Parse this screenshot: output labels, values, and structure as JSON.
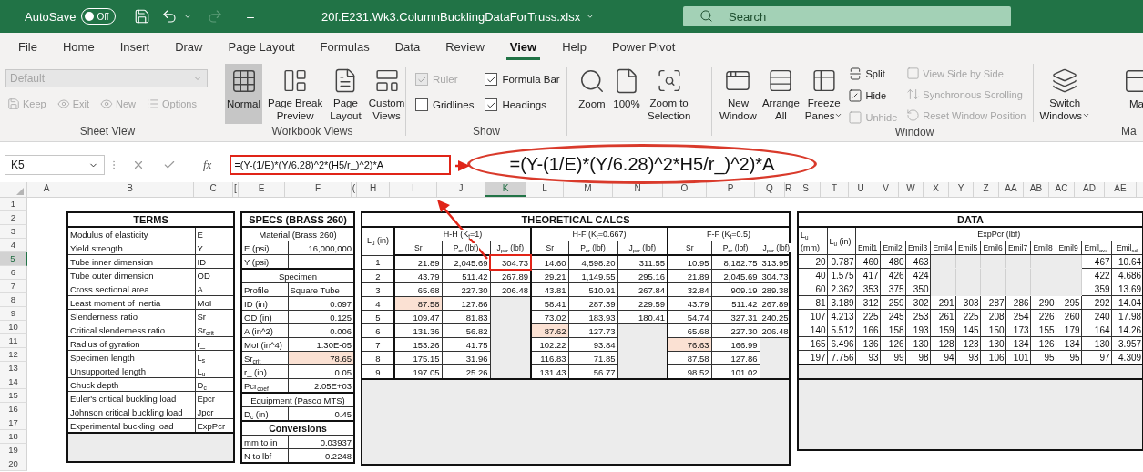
{
  "title_bar": {
    "autosave_label": "AutoSave",
    "autosave": {
      "on": false,
      "label": "Off"
    },
    "redo": {
      "disabled": true
    },
    "filename": "20f.E231.Wk3.ColumnBucklingDataForTruss.xlsx",
    "search": {
      "placeholder": "Search"
    }
  },
  "menu_tabs": [
    {
      "label": "File",
      "selected": false
    },
    {
      "label": "Home",
      "selected": false
    },
    {
      "label": "Insert",
      "selected": false
    },
    {
      "label": "Draw",
      "selected": false
    },
    {
      "label": "Page Layout",
      "selected": false
    },
    {
      "label": "Formulas",
      "selected": false
    },
    {
      "label": "Data",
      "selected": false
    },
    {
      "label": "Review",
      "selected": false
    },
    {
      "label": "View",
      "selected": true
    },
    {
      "label": "Help",
      "selected": false
    },
    {
      "label": "Power Pivot",
      "selected": false
    }
  ],
  "ribbon": {
    "sheet_view": {
      "label": "Sheet View",
      "dropdown": {
        "value": "Default",
        "disabled": true
      },
      "buttons": [
        {
          "label": "Keep",
          "disabled": true
        },
        {
          "label": "Exit",
          "disabled": true
        },
        {
          "label": "New",
          "disabled": true
        },
        {
          "label": "Options",
          "disabled": true
        }
      ]
    },
    "workbook_views": {
      "label": "Workbook Views",
      "buttons": [
        {
          "lines": [
            "Normal"
          ],
          "selected": true
        },
        {
          "lines": [
            "Page Break",
            "Preview"
          ],
          "selected": false
        },
        {
          "lines": [
            "Page",
            "Layout"
          ],
          "selected": false
        },
        {
          "lines": [
            "Custom",
            "Views"
          ],
          "selected": false
        }
      ]
    },
    "show": {
      "label": "Show",
      "options": [
        {
          "label": "Ruler",
          "checked": true,
          "disabled": true
        },
        {
          "label": "Formula Bar",
          "checked": true,
          "disabled": false
        },
        {
          "label": "Gridlines",
          "checked": false,
          "disabled": false
        },
        {
          "label": "Headings",
          "checked": true,
          "disabled": false
        }
      ]
    },
    "zoom": {
      "buttons": [
        {
          "lines": [
            "Zoom"
          ]
        },
        {
          "lines": [
            "100%"
          ]
        },
        {
          "lines": [
            "Zoom to",
            "Selection"
          ]
        }
      ]
    },
    "window": {
      "label": "Window",
      "large_buttons": [
        {
          "lines": [
            "New",
            "Window"
          ],
          "dropdown": false
        },
        {
          "lines": [
            "Arrange",
            "All"
          ],
          "dropdown": false
        },
        {
          "lines": [
            "Freeze",
            "Panes"
          ],
          "dropdown": true
        }
      ],
      "small_buttons": [
        {
          "label": "Split",
          "disabled": false
        },
        {
          "label": "Hide",
          "disabled": false
        },
        {
          "label": "Unhide",
          "disabled": true
        }
      ],
      "side_buttons": [
        {
          "label": "View Side by Side",
          "disabled": true
        },
        {
          "label": "Synchronous Scrolling",
          "disabled": true
        },
        {
          "label": "Reset Window Position",
          "disabled": true
        }
      ],
      "switch": {
        "lines": [
          "Switch",
          "Windows"
        ],
        "dropdown": true
      }
    },
    "macros": {
      "button_label": "Ma",
      "group_label": "Ma"
    }
  },
  "formula_bar": {
    "name_box": "K5",
    "function_label": "fx",
    "formula": "=(Y-(1/E)*(Y/6.28)^2*(H5/r_)^2)*A"
  },
  "callout": {
    "text": "=(Y-(1/E)*(Y/6.28)^2*H5/r_)^2)*A"
  },
  "columns": [
    {
      "label": "A",
      "selected": false
    },
    {
      "label": "B",
      "selected": false
    },
    {
      "label": "C",
      "selected": false
    },
    {
      "label": "[",
      "selected": false
    },
    {
      "label": "E",
      "selected": false
    },
    {
      "label": "F",
      "selected": false
    },
    {
      "label": "(",
      "selected": false
    },
    {
      "label": "H",
      "selected": false
    },
    {
      "label": "I",
      "selected": false
    },
    {
      "label": "J",
      "selected": false
    },
    {
      "label": "K",
      "selected": true
    },
    {
      "label": "L",
      "selected": false
    },
    {
      "label": "M",
      "selected": false
    },
    {
      "label": "N",
      "selected": false
    },
    {
      "label": "O",
      "selected": false
    },
    {
      "label": "P",
      "selected": false
    },
    {
      "label": "Q",
      "selected": false
    },
    {
      "label": "R",
      "selected": false
    },
    {
      "label": "S",
      "selected": false
    },
    {
      "label": "T",
      "selected": false
    },
    {
      "label": "U",
      "selected": false
    },
    {
      "label": "V",
      "selected": false
    },
    {
      "label": "W",
      "selected": false
    },
    {
      "label": "X",
      "selected": false
    },
    {
      "label": "Y",
      "selected": false
    },
    {
      "label": "Z",
      "selected": false
    },
    {
      "label": "AA",
      "selected": false
    },
    {
      "label": "AB",
      "selected": false
    },
    {
      "label": "AC",
      "selected": false
    },
    {
      "label": "AD",
      "selected": false
    },
    {
      "label": "AE",
      "selected": false
    }
  ],
  "rows": [
    {
      "label": "1",
      "selected": false
    },
    {
      "label": "2",
      "selected": false
    },
    {
      "label": "3",
      "selected": false
    },
    {
      "label": "4",
      "selected": false
    },
    {
      "label": "5",
      "selected": true
    },
    {
      "label": "6",
      "selected": false
    },
    {
      "label": "7",
      "selected": false
    },
    {
      "label": "8",
      "selected": false
    },
    {
      "label": "9",
      "selected": false
    },
    {
      "label": "10",
      "selected": false
    },
    {
      "label": "11",
      "selected": false
    },
    {
      "label": "12",
      "selected": false
    },
    {
      "label": "13",
      "selected": false
    },
    {
      "label": "14",
      "selected": false
    },
    {
      "label": "15",
      "selected": false
    },
    {
      "label": "16",
      "selected": false
    },
    {
      "label": "17",
      "selected": false
    },
    {
      "label": "18",
      "selected": false
    },
    {
      "label": "19",
      "selected": false
    },
    {
      "label": "20",
      "selected": false
    }
  ],
  "terms": {
    "title": "TERMS",
    "rows": [
      {
        "term": "Modulus of elasticity",
        "symbol": "E"
      },
      {
        "term": "Yield strength",
        "symbol": "Y"
      },
      {
        "term": "Tube inner dimension",
        "symbol": "ID"
      },
      {
        "term": "Tube outer dimension",
        "symbol": "OD"
      },
      {
        "term": "Cross sectional area",
        "symbol": "A"
      },
      {
        "term": "Least moment of inertia",
        "symbol": "MoI"
      },
      {
        "term": "Slenderness ratio",
        "symbol": "Sr"
      },
      {
        "term": "Critical slenderness ratio",
        "symbol": "Sr$_{crit}$"
      },
      {
        "term": "Radius of gyration",
        "symbol": "r_"
      },
      {
        "term": "Specimen length",
        "symbol": "L$_{s}$"
      },
      {
        "term": "Unsupported length",
        "symbol": "L$_{u}$"
      },
      {
        "term": "Chuck depth",
        "symbol": "D$_{c}$"
      },
      {
        "term": "Euler's critical buckling load",
        "symbol": "Epcr"
      },
      {
        "term": "Johnson critical buckling load",
        "symbol": "Jpcr"
      },
      {
        "term": "Experimental buckling load",
        "symbol": "ExpPcr"
      }
    ]
  },
  "specs": {
    "title": "SPECS (BRASS 260)",
    "rows": [
      {
        "kind": "section",
        "text": "Material (Brass 260)"
      },
      {
        "kind": "pair",
        "label": "E (psi)",
        "value": "16,000,000",
        "highlighted": false
      },
      {
        "kind": "pair",
        "label": "Y (psi)",
        "highlighted": false
      },
      {
        "kind": "section",
        "text": "Specimen"
      },
      {
        "kind": "text_pair",
        "label": "Profile",
        "value": "Square Tube",
        "highlighted": false
      },
      {
        "kind": "pair",
        "label": "ID (in)",
        "value": "0.097",
        "highlighted": false
      },
      {
        "kind": "pair",
        "label": "OD (in)",
        "value": "0.125",
        "highlighted": false
      },
      {
        "kind": "pair",
        "label": "A (in^2)",
        "value": "0.006",
        "highlighted": false
      },
      {
        "kind": "pair",
        "label": "MoI (in^4)",
        "value": "1.30E-05",
        "highlighted": false
      },
      {
        "kind": "pair",
        "label": "Sr$_{crit}$",
        "value": "78.65",
        "highlighted": true
      },
      {
        "kind": "pair",
        "label": "r_ (in)",
        "value": "0.05",
        "highlighted": false
      },
      {
        "kind": "pair",
        "label": "Pcr$_{coef}$",
        "value": "2.05E+03",
        "highlighted": false
      },
      {
        "kind": "section",
        "text": "Equipment (Pasco MTS)"
      },
      {
        "kind": "pair",
        "label": "D$_{c}$ (in)",
        "value": "0.45",
        "highlighted": false
      },
      {
        "kind": "heading",
        "text": "Conversions"
      },
      {
        "kind": "pair",
        "label": "mm to in",
        "value": "0.03937",
        "highlighted": false
      },
      {
        "kind": "pair",
        "label": "N to lbf",
        "value": "0.2248",
        "highlighted": false
      }
    ]
  },
  "theoretical": {
    "title": "THEORETICAL CALCS",
    "lu_header": "L$_{u}$ (in)",
    "groups": [
      {
        "label": "H-H (K$_{t}$=1)",
        "columns": [
          "Sr",
          "P$_{cr}$ (lbf)",
          "J$_{pcr}$ (lbf)"
        ]
      },
      {
        "label": "H-F (K$_{t}$=0.667)",
        "columns": [
          "Sr",
          "P$_{cr}$ (lbf)",
          "J$_{pcr}$ (lbf)"
        ]
      },
      {
        "label": "F-F (K$_{t}$=0.5)",
        "columns": [
          "Sr",
          "P$_{cr}$ (lbf)",
          "J$_{pcr}$ (lbf)"
        ]
      }
    ],
    "rows": [
      {
        "lu": "1",
        "cells": [
          {
            "text": "21.89",
            "highlighted": false
          },
          {
            "text": "2,045.69",
            "highlighted": false
          },
          {
            "text": "304.73",
            "highlighted": false
          },
          {
            "text": "14.60",
            "highlighted": false
          },
          {
            "text": "4,598.20",
            "highlighted": false
          },
          {
            "text": "311.55",
            "highlighted": false
          },
          {
            "text": "10.95",
            "highlighted": false
          },
          {
            "text": "8,182.75",
            "highlighted": false
          },
          {
            "text": "313.95",
            "highlighted": false
          }
        ]
      },
      {
        "lu": "2",
        "cells": [
          {
            "text": "43.79",
            "highlighted": false
          },
          {
            "text": "511.42",
            "highlighted": false
          },
          {
            "text": "267.89",
            "highlighted": false
          },
          {
            "text": "29.21",
            "highlighted": false
          },
          {
            "text": "1,149.55",
            "highlighted": false
          },
          {
            "text": "295.16",
            "highlighted": false
          },
          {
            "text": "21.89",
            "highlighted": false
          },
          {
            "text": "2,045.69",
            "highlighted": false
          },
          {
            "text": "304.73",
            "highlighted": false
          }
        ]
      },
      {
        "lu": "3",
        "cells": [
          {
            "text": "65.68",
            "highlighted": false
          },
          {
            "text": "227.30",
            "highlighted": false
          },
          {
            "text": "206.48",
            "highlighted": false
          },
          {
            "text": "43.81",
            "highlighted": false
          },
          {
            "text": "510.91",
            "highlighted": false
          },
          {
            "text": "267.84",
            "highlighted": false
          },
          {
            "text": "32.84",
            "highlighted": false
          },
          {
            "text": "909.19",
            "highlighted": false
          },
          {
            "text": "289.38",
            "highlighted": false
          }
        ]
      },
      {
        "lu": "4",
        "cells": [
          {
            "text": "87.58",
            "highlighted": true
          },
          {
            "text": "127.86",
            "highlighted": false
          },
          null,
          {
            "text": "58.41",
            "highlighted": false
          },
          {
            "text": "287.39",
            "highlighted": false
          },
          {
            "text": "229.59",
            "highlighted": false
          },
          {
            "text": "43.79",
            "highlighted": false
          },
          {
            "text": "511.42",
            "highlighted": false
          },
          {
            "text": "267.89",
            "highlighted": false
          }
        ]
      },
      {
        "lu": "5",
        "cells": [
          {
            "text": "109.47",
            "highlighted": false
          },
          {
            "text": "81.83",
            "highlighted": false
          },
          null,
          {
            "text": "73.02",
            "highlighted": false
          },
          {
            "text": "183.93",
            "highlighted": false
          },
          {
            "text": "180.41",
            "highlighted": false
          },
          {
            "text": "54.74",
            "highlighted": false
          },
          {
            "text": "327.31",
            "highlighted": false
          },
          {
            "text": "240.25",
            "highlighted": false
          }
        ]
      },
      {
        "lu": "6",
        "cells": [
          {
            "text": "131.36",
            "highlighted": false
          },
          {
            "text": "56.82",
            "highlighted": false
          },
          null,
          {
            "text": "87.62",
            "highlighted": true
          },
          {
            "text": "127.73",
            "highlighted": false
          },
          null,
          {
            "text": "65.68",
            "highlighted": false
          },
          {
            "text": "227.30",
            "highlighted": false
          },
          {
            "text": "206.48",
            "highlighted": false
          }
        ]
      },
      {
        "lu": "7",
        "cells": [
          {
            "text": "153.26",
            "highlighted": false
          },
          {
            "text": "41.75",
            "highlighted": false
          },
          null,
          {
            "text": "102.22",
            "highlighted": false
          },
          {
            "text": "93.84",
            "highlighted": false
          },
          null,
          {
            "text": "76.63",
            "highlighted": true
          },
          {
            "text": "166.99",
            "highlighted": false
          },
          null
        ]
      },
      {
        "lu": "8",
        "cells": [
          {
            "text": "175.15",
            "highlighted": false
          },
          {
            "text": "31.96",
            "highlighted": false
          },
          null,
          {
            "text": "116.83",
            "highlighted": false
          },
          {
            "text": "71.85",
            "highlighted": false
          },
          null,
          {
            "text": "87.58",
            "highlighted": false
          },
          {
            "text": "127.86",
            "highlighted": false
          },
          null
        ]
      },
      {
        "lu": "9",
        "cells": [
          {
            "text": "197.05",
            "highlighted": false
          },
          {
            "text": "25.26",
            "highlighted": false
          },
          null,
          {
            "text": "131.43",
            "highlighted": false
          },
          {
            "text": "56.77",
            "highlighted": false
          },
          null,
          {
            "text": "98.52",
            "highlighted": false
          },
          {
            "text": "101.02",
            "highlighted": false
          },
          null
        ]
      }
    ]
  },
  "data": {
    "title": "DATA",
    "group_label": "ExpPcr (lbf)",
    "columns": [
      "L$_{u}$ (mm)",
      "L$_{u}$ (in)",
      "Emil1",
      "Emil2",
      "Emil3",
      "Emil4",
      "Emil5",
      "Emil6",
      "Emil7",
      "Emil8",
      "Emil9",
      "Emil$_{ave}$",
      "Emil$_{sd}$"
    ],
    "rows": [
      [
        "20",
        "0.787",
        "460",
        "480",
        "463",
        null,
        null,
        null,
        null,
        null,
        null,
        "467",
        "10.64"
      ],
      [
        "40",
        "1.575",
        "417",
        "426",
        "424",
        null,
        null,
        null,
        null,
        null,
        null,
        "422",
        "4.686"
      ],
      [
        "60",
        "2.362",
        "353",
        "375",
        "350",
        null,
        null,
        null,
        null,
        null,
        null,
        "359",
        "13.69"
      ],
      [
        "81",
        "3.189",
        "312",
        "259",
        "302",
        "291",
        "303",
        "287",
        "286",
        "290",
        "295",
        "292",
        "14.04"
      ],
      [
        "107",
        "4.213",
        "225",
        "245",
        "253",
        "261",
        "225",
        "208",
        "254",
        "226",
        "260",
        "240",
        "17.98"
      ],
      [
        "140",
        "5.512",
        "166",
        "158",
        "193",
        "159",
        "145",
        "150",
        "173",
        "155",
        "179",
        "164",
        "14.26"
      ],
      [
        "165",
        "6.496",
        "136",
        "126",
        "130",
        "128",
        "123",
        "130",
        "134",
        "126",
        "134",
        "130",
        "3.957"
      ],
      [
        "197",
        "7.756",
        "93",
        "99",
        "98",
        "94",
        "93",
        "106",
        "101",
        "95",
        "95",
        "97",
        "4.309"
      ]
    ]
  }
}
